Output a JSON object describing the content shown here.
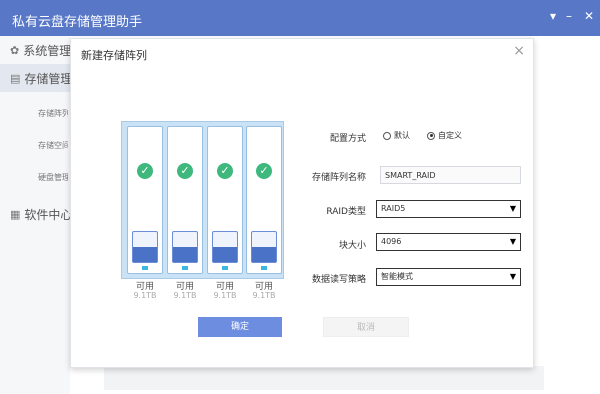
{
  "app": {
    "title": "私有云盘存储管理助手",
    "controls": [
      "▾",
      "–",
      "✕"
    ]
  },
  "sidebar": {
    "items": [
      {
        "icon": "gear-icon",
        "glyph": "✿",
        "label": "系统管理"
      },
      {
        "icon": "storage-icon",
        "glyph": "▤",
        "label": "存储管理"
      },
      {
        "icon": "apps-icon",
        "glyph": "▦",
        "label": "软件中心"
      }
    ],
    "subitems": [
      "存储阵列",
      "存储空间",
      "硬盘管理"
    ]
  },
  "dialog": {
    "title": "新建存储阵列",
    "close": "×",
    "disks": [
      {
        "status": "可用",
        "capacity": "9.1TB"
      },
      {
        "status": "可用",
        "capacity": "9.1TB"
      },
      {
        "status": "可用",
        "capacity": "9.1TB"
      },
      {
        "status": "可用",
        "capacity": "9.1TB"
      }
    ],
    "form": {
      "config_label": "配置方式",
      "config_options": [
        "默认",
        "自定义"
      ],
      "config_selected": "自定义",
      "name_label": "存储阵列名称",
      "name_value": "SMART_RAID",
      "raid_label": "RAID类型",
      "raid_value": "RAID5",
      "block_label": "块大小",
      "block_value": "4096",
      "policy_label": "数据读写策略",
      "policy_value": "智能模式"
    },
    "buttons": {
      "ok": "确定",
      "cancel": "取消"
    }
  },
  "colors": {
    "titlebar": "#5877c6",
    "accent": "#6d8ee0",
    "check": "#3fb87d",
    "disk_fill": "#4a73c8"
  }
}
